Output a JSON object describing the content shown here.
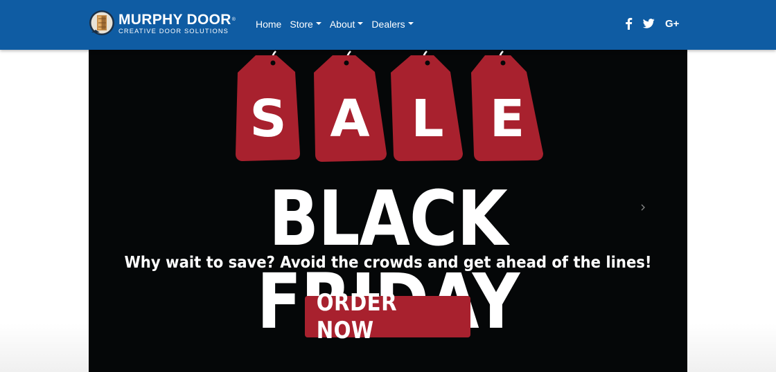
{
  "brand": {
    "name": "MURPHY DOOR",
    "trademark": "®",
    "tagline": "CREATIVE DOOR SOLUTIONS",
    "colors": {
      "navbar": "#0f5ca3",
      "logo_wood": "#d7a15a",
      "logo_ring": "#1b2f45"
    }
  },
  "nav": {
    "items": [
      {
        "label": "Home",
        "dropdown": false
      },
      {
        "label": "Store",
        "dropdown": true
      },
      {
        "label": "About",
        "dropdown": true
      },
      {
        "label": "Dealers",
        "dropdown": true
      }
    ]
  },
  "social": {
    "icons": [
      "facebook-icon",
      "twitter-icon",
      "google-plus-icon"
    ],
    "google_plus_text": "G+"
  },
  "hero": {
    "tag_letters": [
      "S",
      "A",
      "L",
      "E"
    ],
    "headline": "BLACK FRIDAY",
    "subline": "Why wait to save? Avoid the crowds and get ahead of the lines!",
    "cta_label": "ORDER NOW",
    "next_icon": "chevron-right-icon",
    "colors": {
      "background": "#050708",
      "tag_red": "#a8212e",
      "text": "#ffffff"
    }
  }
}
